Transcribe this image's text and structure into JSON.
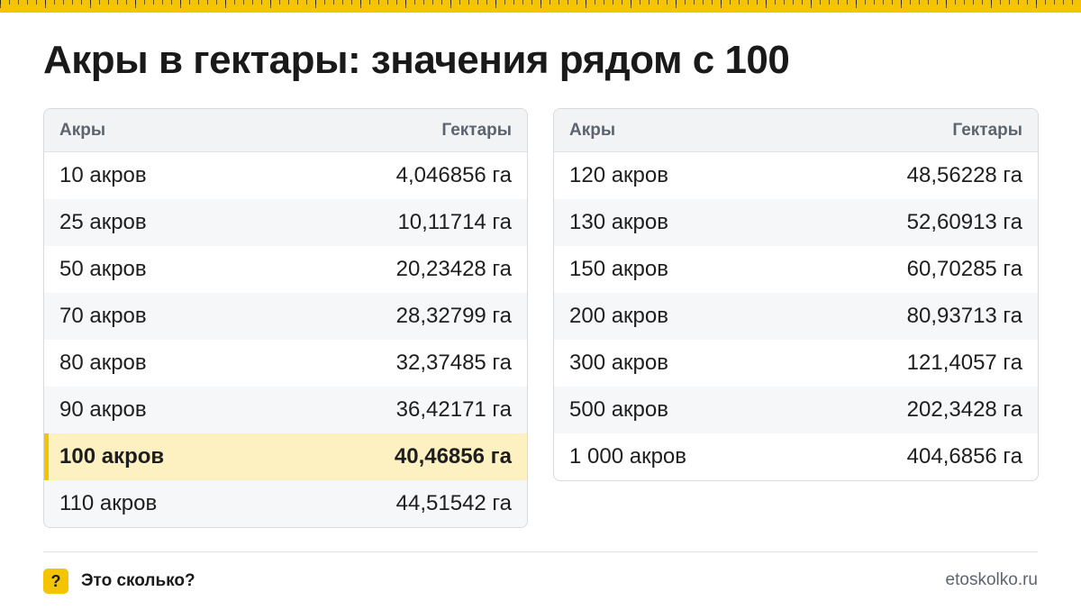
{
  "title": "Акры в гектары: значения рядом с 100",
  "colors": {
    "accent": "#f5c400",
    "highlight_bg": "#fdf1c1",
    "header_bg": "#f2f3f5"
  },
  "tables": [
    {
      "header": {
        "left": "Акры",
        "right": "Гектары"
      },
      "rows": [
        {
          "acres": "10 акров",
          "hectares": "4,046856 га"
        },
        {
          "acres": "25 акров",
          "hectares": "10,11714 га"
        },
        {
          "acres": "50 акров",
          "hectares": "20,23428 га"
        },
        {
          "acres": "70 акров",
          "hectares": "28,32799 га"
        },
        {
          "acres": "80 акров",
          "hectares": "32,37485 га"
        },
        {
          "acres": "90 акров",
          "hectares": "36,42171 га"
        },
        {
          "acres": "100 акров",
          "hectares": "40,46856 га",
          "highlighted": true
        },
        {
          "acres": "110 акров",
          "hectares": "44,51542 га"
        }
      ]
    },
    {
      "header": {
        "left": "Акры",
        "right": "Гектары"
      },
      "rows": [
        {
          "acres": "120 акров",
          "hectares": "48,56228 га"
        },
        {
          "acres": "130 акров",
          "hectares": "52,60913 га"
        },
        {
          "acres": "150 акров",
          "hectares": "60,70285 га"
        },
        {
          "acres": "200 акров",
          "hectares": "80,93713 га"
        },
        {
          "acres": "300 акров",
          "hectares": "121,4057 га"
        },
        {
          "acres": "500 акров",
          "hectares": "202,3428 га"
        },
        {
          "acres": "1 000 акров",
          "hectares": "404,6856 га"
        }
      ]
    }
  ],
  "footer": {
    "brand_icon": "?",
    "brand_icon_name": "question-icon",
    "brand_name": "Это сколько?",
    "site": "etoskolko.ru"
  }
}
